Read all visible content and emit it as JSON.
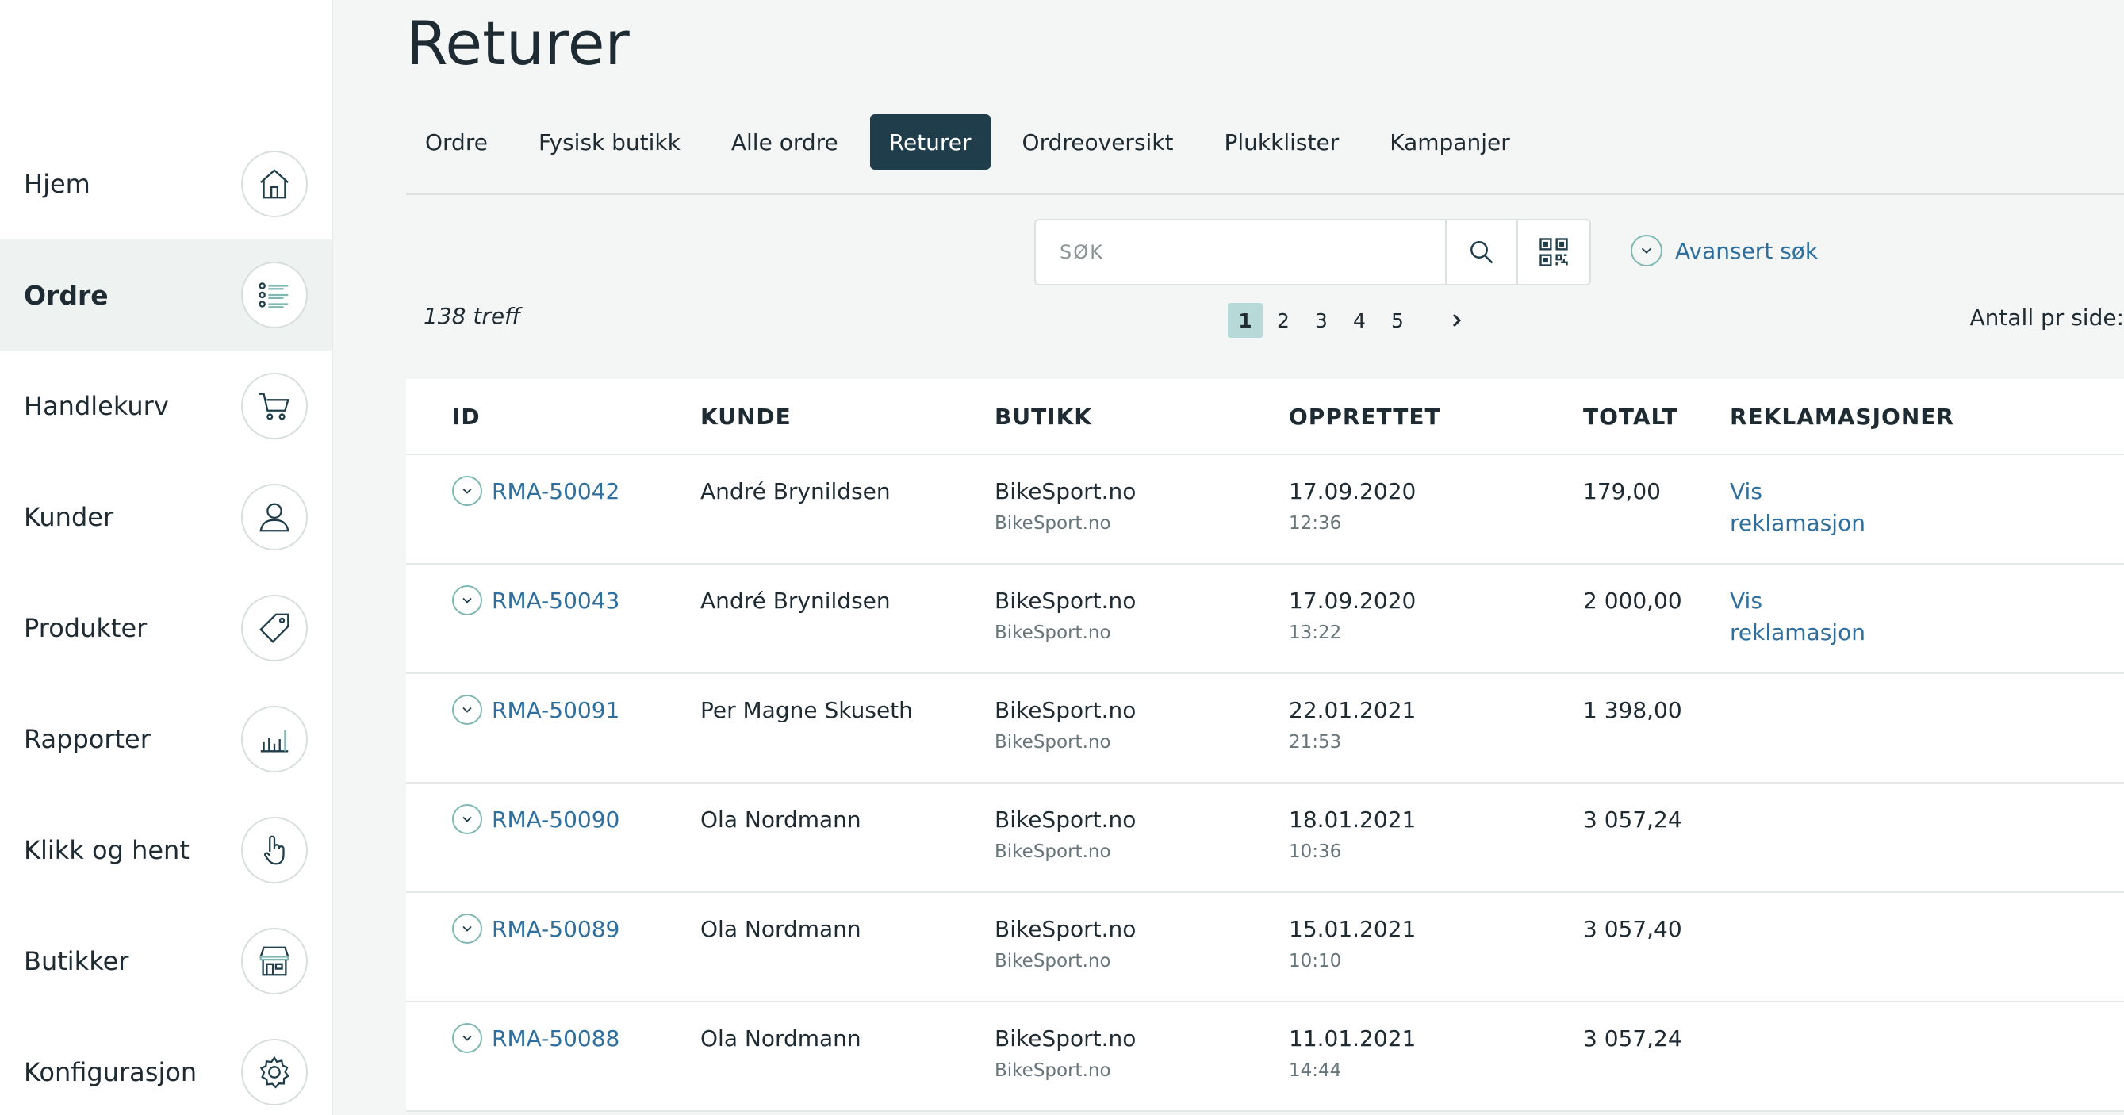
{
  "nav": {
    "items": [
      {
        "label": "Hjem",
        "icon": "home-icon"
      },
      {
        "label": "Ordre",
        "icon": "list-icon",
        "active": true
      },
      {
        "label": "Handlekurv",
        "icon": "cart-icon"
      },
      {
        "label": "Kunder",
        "icon": "user-icon"
      },
      {
        "label": "Produkter",
        "icon": "tag-icon"
      },
      {
        "label": "Rapporter",
        "icon": "bar-chart-icon"
      },
      {
        "label": "Klikk og hent",
        "icon": "hand-pointer-icon"
      },
      {
        "label": "Butikker",
        "icon": "store-icon"
      },
      {
        "label": "Konfigurasjon",
        "icon": "gear-icon"
      }
    ]
  },
  "page": {
    "title": "Returer"
  },
  "tabs": [
    {
      "label": "Ordre"
    },
    {
      "label": "Fysisk butikk"
    },
    {
      "label": "Alle ordre"
    },
    {
      "label": "Returer",
      "active": true
    },
    {
      "label": "Ordreoversikt"
    },
    {
      "label": "Plukklister"
    },
    {
      "label": "Kampanjer"
    }
  ],
  "search": {
    "placeholder": "SØK",
    "advanced_label": "Avansert søk"
  },
  "results": {
    "hits": "138 treff",
    "per_page_label": "Antall pr side:"
  },
  "pagination": {
    "pages": [
      "1",
      "2",
      "3",
      "4",
      "5"
    ],
    "current": "1"
  },
  "table": {
    "headers": {
      "id": "ID",
      "kunde": "KUNDE",
      "butikk": "BUTIKK",
      "opprettet": "OPPRETTET",
      "totalt": "TOTALT",
      "reklamasjoner": "REKLAMASJONER"
    },
    "rows": [
      {
        "id": "RMA-50042",
        "kunde": "André Brynildsen",
        "butikk": "BikeSport.no",
        "butikk_sub": "BikeSport.no",
        "dato": "17.09.2020",
        "tid": "12:36",
        "totalt": "179,00",
        "rek": "Vis reklamasjon"
      },
      {
        "id": "RMA-50043",
        "kunde": "André Brynildsen",
        "butikk": "BikeSport.no",
        "butikk_sub": "BikeSport.no",
        "dato": "17.09.2020",
        "tid": "13:22",
        "totalt": "2 000,00",
        "rek": "Vis reklamasjon"
      },
      {
        "id": "RMA-50091",
        "kunde": "Per Magne Skuseth",
        "butikk": "BikeSport.no",
        "butikk_sub": "BikeSport.no",
        "dato": "22.01.2021",
        "tid": "21:53",
        "totalt": "1 398,00",
        "rek": ""
      },
      {
        "id": "RMA-50090",
        "kunde": "Ola Nordmann",
        "butikk": "BikeSport.no",
        "butikk_sub": "BikeSport.no",
        "dato": "18.01.2021",
        "tid": "10:36",
        "totalt": "3 057,24",
        "rek": ""
      },
      {
        "id": "RMA-50089",
        "kunde": "Ola Nordmann",
        "butikk": "BikeSport.no",
        "butikk_sub": "BikeSport.no",
        "dato": "15.01.2021",
        "tid": "10:10",
        "totalt": "3 057,40",
        "rek": ""
      },
      {
        "id": "RMA-50088",
        "kunde": "Ola Nordmann",
        "butikk": "BikeSport.no",
        "butikk_sub": "BikeSport.no",
        "dato": "11.01.2021",
        "tid": "14:44",
        "totalt": "3 057,24",
        "rek": ""
      }
    ]
  },
  "colors": {
    "accent": "#1f3d4a",
    "link": "#2f6f9e",
    "teal": "#7fb8b3",
    "active_page": "#b7dad8"
  }
}
